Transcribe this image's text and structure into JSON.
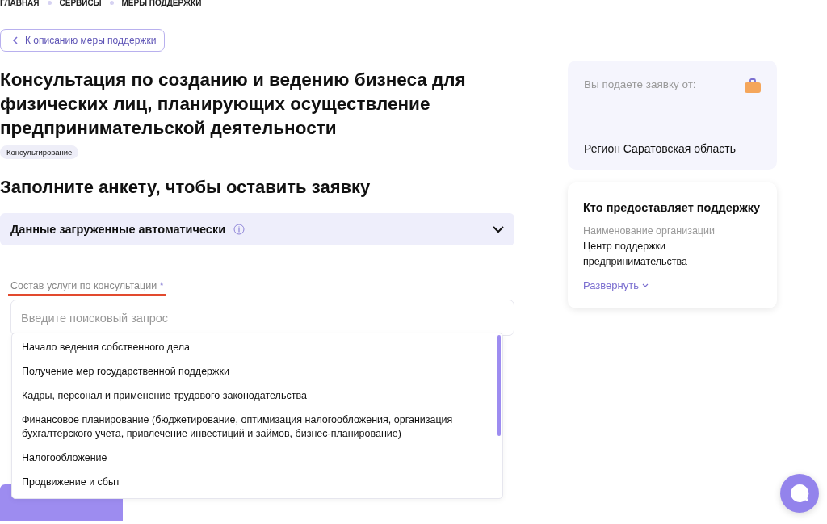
{
  "breadcrumbs": [
    "ГЛАВНАЯ",
    "СЕРВИСЫ",
    "МЕРЫ ПОДДЕРЖКИ"
  ],
  "back_link": "К описанию меры поддержки",
  "title": "Консультация по созданию и ведению бизнеса для физических лиц, планирующих осуществление предпринимательской деятельности",
  "tag": "Консультирование",
  "form_title": "Заполните анкету, чтобы оставить заявку",
  "auto_section": {
    "title": "Данные загруженные автоматически",
    "expanded": false
  },
  "field": {
    "label": "Состав услуги по консультации",
    "required_mark": "*",
    "placeholder": "Введите поисковый запрос",
    "error": true
  },
  "options": [
    {
      "label": "Начало ведения собственного дела"
    },
    {
      "label": "Получение мер государственной поддержки"
    },
    {
      "label": "Кадры, персонал и применение трудового законодательства"
    },
    {
      "label": "Финансовое планирование (бюджетирование, оптимизация налогообложения, организация бухгалтерского учета, привлечение инвестиций и займов, бизнес-планирование)"
    },
    {
      "label": "Налогообложение"
    },
    {
      "label": "Продвижение и сбыт"
    }
  ],
  "applicant_card": {
    "label": "Вы подаете заявку от:",
    "value": "Регион Саратовская область"
  },
  "provider_card": {
    "title": "Кто предоставляет поддержку",
    "org_label": "Наименование организации",
    "org_name": "Центр поддержки предпринимательства",
    "expand_link": "Развернуть"
  }
}
